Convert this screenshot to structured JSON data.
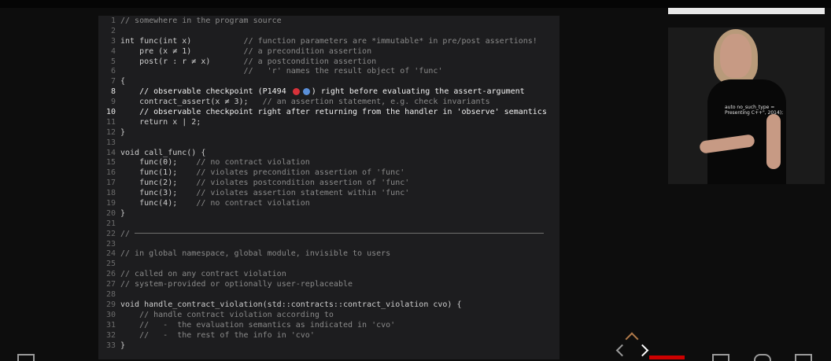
{
  "slide": {
    "lines": [
      {
        "n": "1",
        "parts": [
          {
            "t": "// somewhere in the program source",
            "c": "cmt"
          }
        ]
      },
      {
        "n": "2",
        "parts": [
          {
            "t": "",
            "c": ""
          }
        ]
      },
      {
        "n": "3",
        "parts": [
          {
            "t": "int func(int x)           ",
            "c": "kw"
          },
          {
            "t": "// function parameters are *immutable* in pre/post assertions!",
            "c": "cmt"
          }
        ]
      },
      {
        "n": "4",
        "parts": [
          {
            "t": "    pre (x ≠ 1)           ",
            "c": "kw"
          },
          {
            "t": "// a precondition assertion",
            "c": "cmt"
          }
        ]
      },
      {
        "n": "5",
        "parts": [
          {
            "t": "    post(r : r ≠ x)       ",
            "c": "kw"
          },
          {
            "t": "// a postcondition assertion",
            "c": "cmt"
          }
        ]
      },
      {
        "n": "6",
        "parts": [
          {
            "t": "                          ",
            "c": ""
          },
          {
            "t": "//   'r' names the result object of 'func'",
            "c": "cmt"
          }
        ]
      },
      {
        "n": "7",
        "parts": [
          {
            "t": "{",
            "c": "kw"
          }
        ]
      },
      {
        "n": "8",
        "hl": true,
        "parts": [
          {
            "t": "    // observable checkpoint (P1494 ",
            "c": "bright"
          },
          {
            "t": "",
            "c": "emoji"
          },
          {
            "t": ") right before evaluating the assert-argument",
            "c": "bright"
          }
        ]
      },
      {
        "n": "9",
        "parts": [
          {
            "t": "    contract_assert(x ≠ 3);   ",
            "c": "kw"
          },
          {
            "t": "// an assertion statement, e.g. check invariants",
            "c": "cmt"
          }
        ]
      },
      {
        "n": "10",
        "hl": true,
        "parts": [
          {
            "t": "    // observable checkpoint right after returning from the handler in 'observe' semantics",
            "c": "bright"
          }
        ]
      },
      {
        "n": "11",
        "parts": [
          {
            "t": "    return x | 2;",
            "c": "kw"
          }
        ]
      },
      {
        "n": "12",
        "parts": [
          {
            "t": "}",
            "c": "kw"
          }
        ]
      },
      {
        "n": "13",
        "parts": [
          {
            "t": "",
            "c": ""
          }
        ]
      },
      {
        "n": "14",
        "parts": [
          {
            "t": "void call_func() {",
            "c": "kw"
          }
        ]
      },
      {
        "n": "15",
        "parts": [
          {
            "t": "    func(0);    ",
            "c": "kw"
          },
          {
            "t": "// no contract violation",
            "c": "cmt"
          }
        ]
      },
      {
        "n": "16",
        "parts": [
          {
            "t": "    func(1);    ",
            "c": "kw"
          },
          {
            "t": "// violates precondition assertion of 'func'",
            "c": "cmt"
          }
        ]
      },
      {
        "n": "17",
        "parts": [
          {
            "t": "    func(2);    ",
            "c": "kw"
          },
          {
            "t": "// violates postcondition assertion of 'func'",
            "c": "cmt"
          }
        ]
      },
      {
        "n": "18",
        "parts": [
          {
            "t": "    func(3);    ",
            "c": "kw"
          },
          {
            "t": "// violates assertion statement within 'func'",
            "c": "cmt"
          }
        ]
      },
      {
        "n": "19",
        "parts": [
          {
            "t": "    func(4);    ",
            "c": "kw"
          },
          {
            "t": "// no contract violation",
            "c": "cmt"
          }
        ]
      },
      {
        "n": "20",
        "parts": [
          {
            "t": "}",
            "c": "kw"
          }
        ]
      },
      {
        "n": "21",
        "parts": [
          {
            "t": "",
            "c": ""
          }
        ]
      },
      {
        "n": "22",
        "parts": [
          {
            "t": "//",
            "c": "cmt"
          },
          {
            "t": "",
            "c": "rule"
          }
        ]
      },
      {
        "n": "23",
        "parts": [
          {
            "t": "",
            "c": ""
          }
        ]
      },
      {
        "n": "24",
        "parts": [
          {
            "t": "// in global namespace, global module, invisible to users",
            "c": "cmt"
          }
        ]
      },
      {
        "n": "25",
        "parts": [
          {
            "t": "",
            "c": ""
          }
        ]
      },
      {
        "n": "26",
        "parts": [
          {
            "t": "// called on any contract violation",
            "c": "cmt"
          }
        ]
      },
      {
        "n": "27",
        "parts": [
          {
            "t": "// system-provided or optionally user-replaceable",
            "c": "cmt"
          }
        ]
      },
      {
        "n": "28",
        "parts": [
          {
            "t": "",
            "c": ""
          }
        ]
      },
      {
        "n": "29",
        "parts": [
          {
            "t": "void handle_contract_violation(std::contracts::contract_violation cvo) {",
            "c": "kw"
          }
        ]
      },
      {
        "n": "30",
        "parts": [
          {
            "t": "    // handle contract violation according to",
            "c": "cmt"
          }
        ]
      },
      {
        "n": "31",
        "parts": [
          {
            "t": "    //   -  the evaluation semantics as indicated in 'cvo'",
            "c": "cmt"
          }
        ]
      },
      {
        "n": "32",
        "parts": [
          {
            "t": "    //   -  the rest of the info in 'cvo'",
            "c": "cmt"
          }
        ]
      },
      {
        "n": "33",
        "parts": [
          {
            "t": "}",
            "c": "kw"
          }
        ]
      }
    ]
  },
  "speaker": {
    "shirt_lines": [
      "auto no_such_type =",
      "Presenting C++\", 2014);"
    ]
  },
  "colors": {
    "slide_bg": "#1d1d1f",
    "comment": "#8a8a8a",
    "code": "#c7c7c7",
    "progress": "#cc0000"
  }
}
